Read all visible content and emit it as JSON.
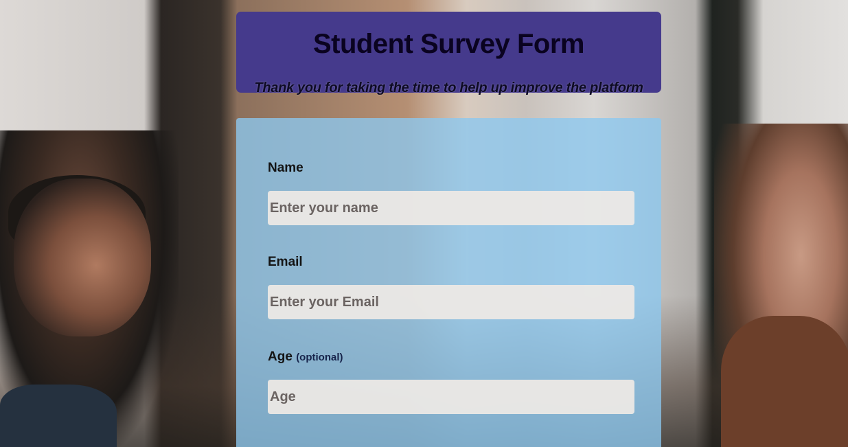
{
  "header": {
    "title": "Student Survey Form",
    "subtitle": "Thank you for taking the time to help up improve the platform"
  },
  "form": {
    "name": {
      "label": "Name",
      "placeholder": "Enter your name"
    },
    "email": {
      "label": "Email",
      "placeholder": "Enter your Email"
    },
    "age": {
      "label": "Age",
      "note": "(optional)",
      "placeholder": "Age"
    }
  },
  "colors": {
    "header_bg": "#453a8c",
    "form_bg": "#8cc8f0",
    "input_bg": "#eee9e5"
  }
}
